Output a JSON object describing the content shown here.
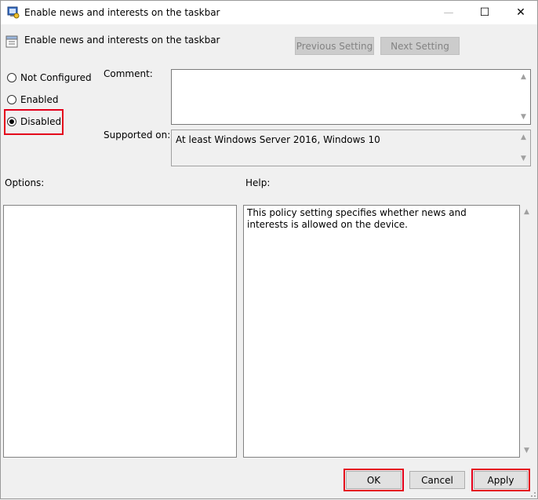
{
  "window": {
    "title": "Enable news and interests on the taskbar",
    "controls": {
      "minimize": "—",
      "maximize": "☐",
      "close": "✕"
    }
  },
  "header": {
    "policy_name": "Enable news and interests on the taskbar",
    "previous_setting": "Previous Setting",
    "next_setting": "Next Setting"
  },
  "state": {
    "options": [
      {
        "label": "Not Configured",
        "checked": false
      },
      {
        "label": "Enabled",
        "checked": false
      },
      {
        "label": "Disabled",
        "checked": true
      }
    ]
  },
  "comment": {
    "label": "Comment:",
    "value": ""
  },
  "supported": {
    "label": "Supported on:",
    "value": "At least Windows Server 2016, Windows 10"
  },
  "options_pane": {
    "label": "Options:"
  },
  "help_pane": {
    "label": "Help:",
    "text": "This policy setting specifies whether news and interests is allowed on the device."
  },
  "footer": {
    "ok": "OK",
    "cancel": "Cancel",
    "apply": "Apply"
  },
  "colors": {
    "highlight": "#e4001b",
    "background": "#f0f0f0"
  }
}
